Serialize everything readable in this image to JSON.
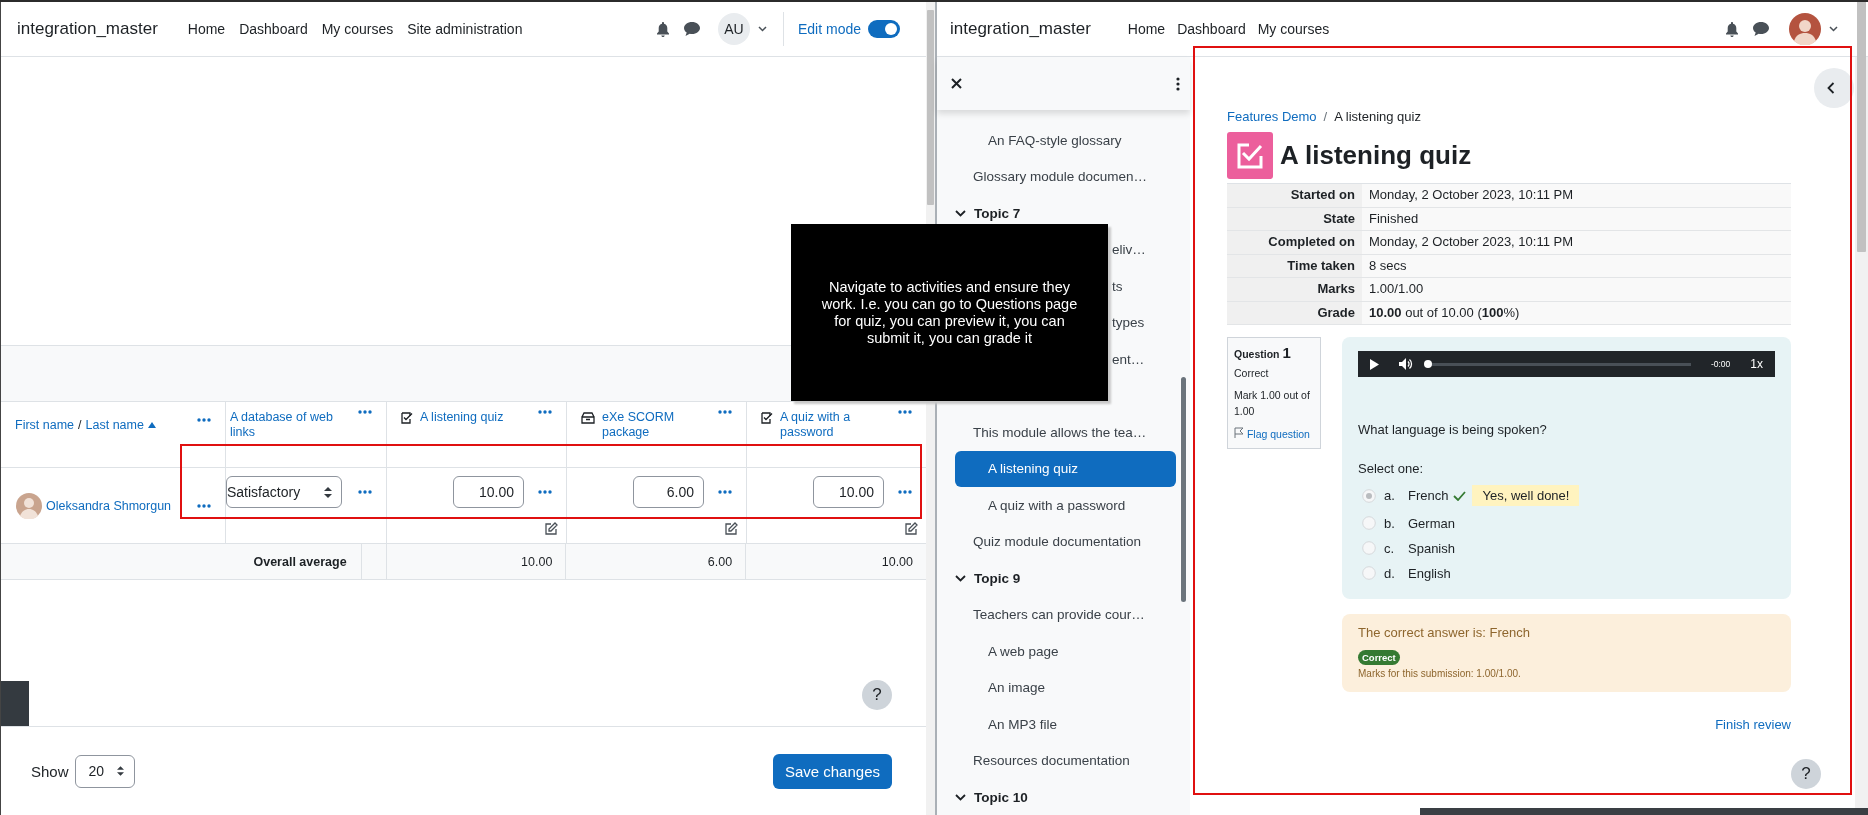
{
  "left": {
    "navbar": {
      "brand": "integration_master",
      "links": [
        "Home",
        "Dashboard",
        "My courses",
        "Site administration"
      ],
      "avatar_initials": "AU",
      "edit_mode": {
        "label": "Edit mode",
        "on": true
      }
    },
    "grader": {
      "name_header": {
        "first": "First name",
        "separator": "/",
        "last": "Last name"
      },
      "columns": [
        {
          "kind": "database",
          "label": "A database of web links"
        },
        {
          "kind": "quiz",
          "label": "A listening quiz"
        },
        {
          "kind": "scorm",
          "label": "eXe SCORM package"
        },
        {
          "kind": "quiz",
          "label": "A quiz with a password"
        }
      ],
      "rows": [
        {
          "student": "Oleksandra Shmorgun",
          "grades": [
            {
              "kind": "select",
              "value": "Satisfactory"
            },
            {
              "kind": "input",
              "value": "10.00"
            },
            {
              "kind": "input",
              "value": "6.00"
            },
            {
              "kind": "input",
              "value": "10.00"
            }
          ]
        }
      ],
      "overall": {
        "label": "Overall average",
        "values": [
          "10.00",
          "6.00",
          "10.00"
        ]
      }
    },
    "footer": {
      "show_label": "Show",
      "per_page": "20",
      "save": "Save changes"
    },
    "help": "?"
  },
  "tooltip": "Navigate to activities and ensure they work. I.e. you can go to Questions page for quiz, you can preview it, you can submit it, you can grade it",
  "right": {
    "navbar": {
      "brand": "integration_master",
      "links": [
        "Home",
        "Dashboard",
        "My courses"
      ]
    },
    "drawer": {
      "items": [
        {
          "kind": "sub",
          "label": "An FAQ-style glossary",
          "selected": false
        },
        {
          "kind": "item",
          "label": "Glossary module documen…",
          "selected": false
        },
        {
          "kind": "topic",
          "label": "Topic 7",
          "expanded": true,
          "selected": false
        },
        {
          "kind": "fragment",
          "label": "eliv…",
          "selected": false
        },
        {
          "kind": "fragment",
          "label": "ts",
          "selected": false
        },
        {
          "kind": "fragment",
          "label": "types",
          "selected": false
        },
        {
          "kind": "fragment",
          "label": "ent…",
          "selected": false
        },
        {
          "kind": "item",
          "label": "This module allows the tea…",
          "selected": false
        },
        {
          "kind": "sub",
          "label": "A listening quiz",
          "selected": true
        },
        {
          "kind": "sub",
          "label": "A quiz with a password",
          "selected": false
        },
        {
          "kind": "item",
          "label": "Quiz module documentation",
          "selected": false
        },
        {
          "kind": "topic",
          "label": "Topic 9",
          "expanded": true,
          "selected": false
        },
        {
          "kind": "item",
          "label": "Teachers can provide cour…",
          "selected": false
        },
        {
          "kind": "sub",
          "label": "A web page",
          "selected": false
        },
        {
          "kind": "sub",
          "label": "An image",
          "selected": false
        },
        {
          "kind": "sub",
          "label": "An MP3 file",
          "selected": false
        },
        {
          "kind": "item",
          "label": "Resources documentation",
          "selected": false
        },
        {
          "kind": "topic",
          "label": "Topic 10",
          "expanded": true,
          "selected": false
        }
      ]
    },
    "quiz": {
      "breadcrumb_separator": "/",
      "breadcrumb": [
        {
          "label": "Features Demo",
          "link": true
        },
        {
          "label": "A listening quiz",
          "link": false
        }
      ],
      "title": "A listening quiz",
      "summary": [
        {
          "label": "Started on",
          "value": "Monday, 2 October 2023, 10:11 PM"
        },
        {
          "label": "State",
          "value": "Finished"
        },
        {
          "label": "Completed on",
          "value": "Monday, 2 October 2023, 10:11 PM"
        },
        {
          "label": "Time taken",
          "value": "8 secs"
        },
        {
          "label": "Marks",
          "value": "1.00/1.00"
        },
        {
          "label": "Grade",
          "value": "**10.00** out of 10.00 (**100**%)"
        }
      ],
      "info": {
        "label": "Question",
        "number": "1",
        "state": "Correct",
        "mark": "Mark 1.00 out of 1.00",
        "flag": "Flag question"
      },
      "player": {
        "level": 0,
        "time": "-0:00",
        "speed": "1x"
      },
      "question": "What language is being spoken?",
      "prompt": "Select one:",
      "options": [
        {
          "letter": "a.",
          "text": "French",
          "selected": true,
          "correct": true,
          "feedback": "Yes, well done!"
        },
        {
          "letter": "b.",
          "text": "German",
          "selected": false,
          "correct": false
        },
        {
          "letter": "c.",
          "text": "Spanish",
          "selected": false,
          "correct": false
        },
        {
          "letter": "d.",
          "text": "English",
          "selected": false,
          "correct": false
        }
      ],
      "feedback": {
        "answer": "The correct answer is: French",
        "badge": "Correct",
        "marks": "Marks for this submission: 1.00/1.00."
      },
      "finish": "Finish review"
    },
    "help": "?"
  }
}
